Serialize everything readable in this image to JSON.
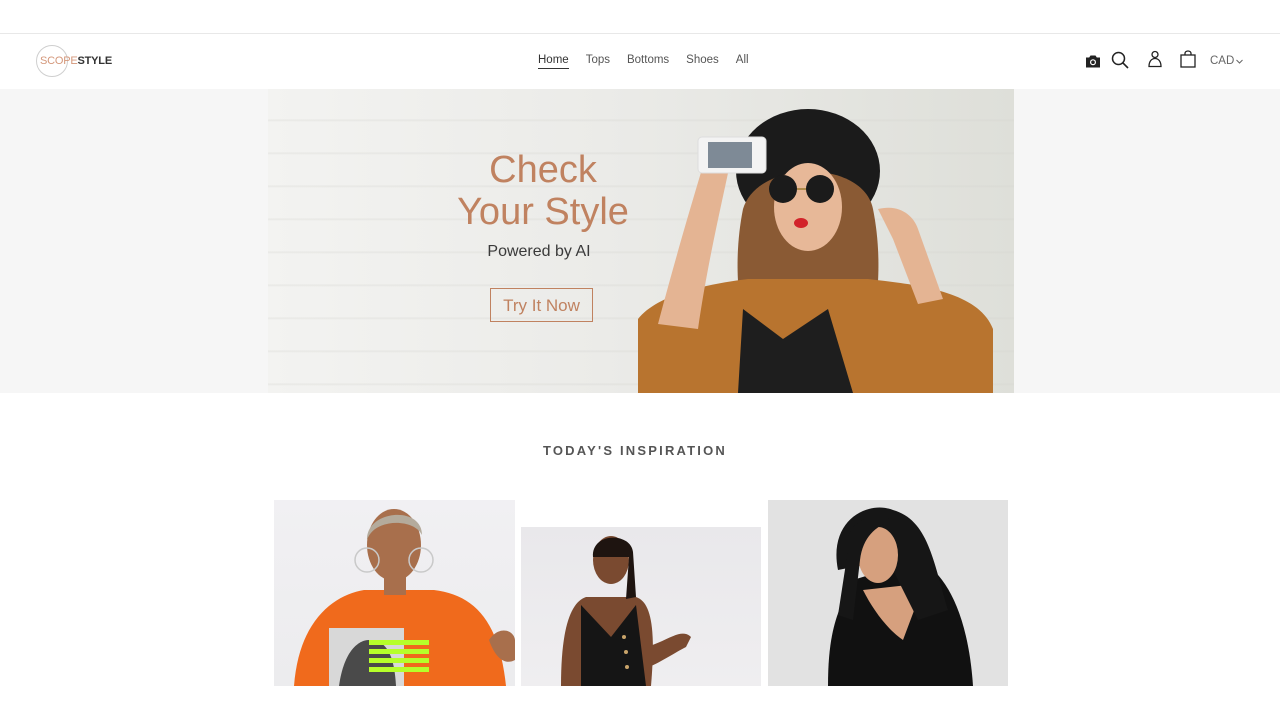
{
  "brand": {
    "name_part1": "SCOPE",
    "name_part2": "STYLE",
    "accent_color": "#c08260"
  },
  "nav": {
    "items": [
      {
        "label": "Home",
        "active": true
      },
      {
        "label": "Tops",
        "active": false
      },
      {
        "label": "Bottoms",
        "active": false
      },
      {
        "label": "Shoes",
        "active": false
      },
      {
        "label": "All",
        "active": false
      }
    ]
  },
  "header_icons": {
    "camera": "camera-icon",
    "search": "search-icon",
    "account": "user-icon",
    "cart": "shopping-bag-icon",
    "currency": "CAD",
    "currency_chevron": "chevron-down-icon"
  },
  "hero": {
    "title_line1": "Check",
    "title_line2": "Your Style",
    "subtitle": "Powered by AI",
    "cta_label": "Try It Now",
    "image_alt": "Woman in black hat and sunglasses taking a selfie"
  },
  "inspiration": {
    "title": "TODAY'S INSPIRATION",
    "cards": [
      {
        "alt": "Model in orange graphic tee"
      },
      {
        "alt": "Model in black sleeveless button jumpsuit"
      },
      {
        "alt": "Model in black wrap top"
      }
    ]
  }
}
